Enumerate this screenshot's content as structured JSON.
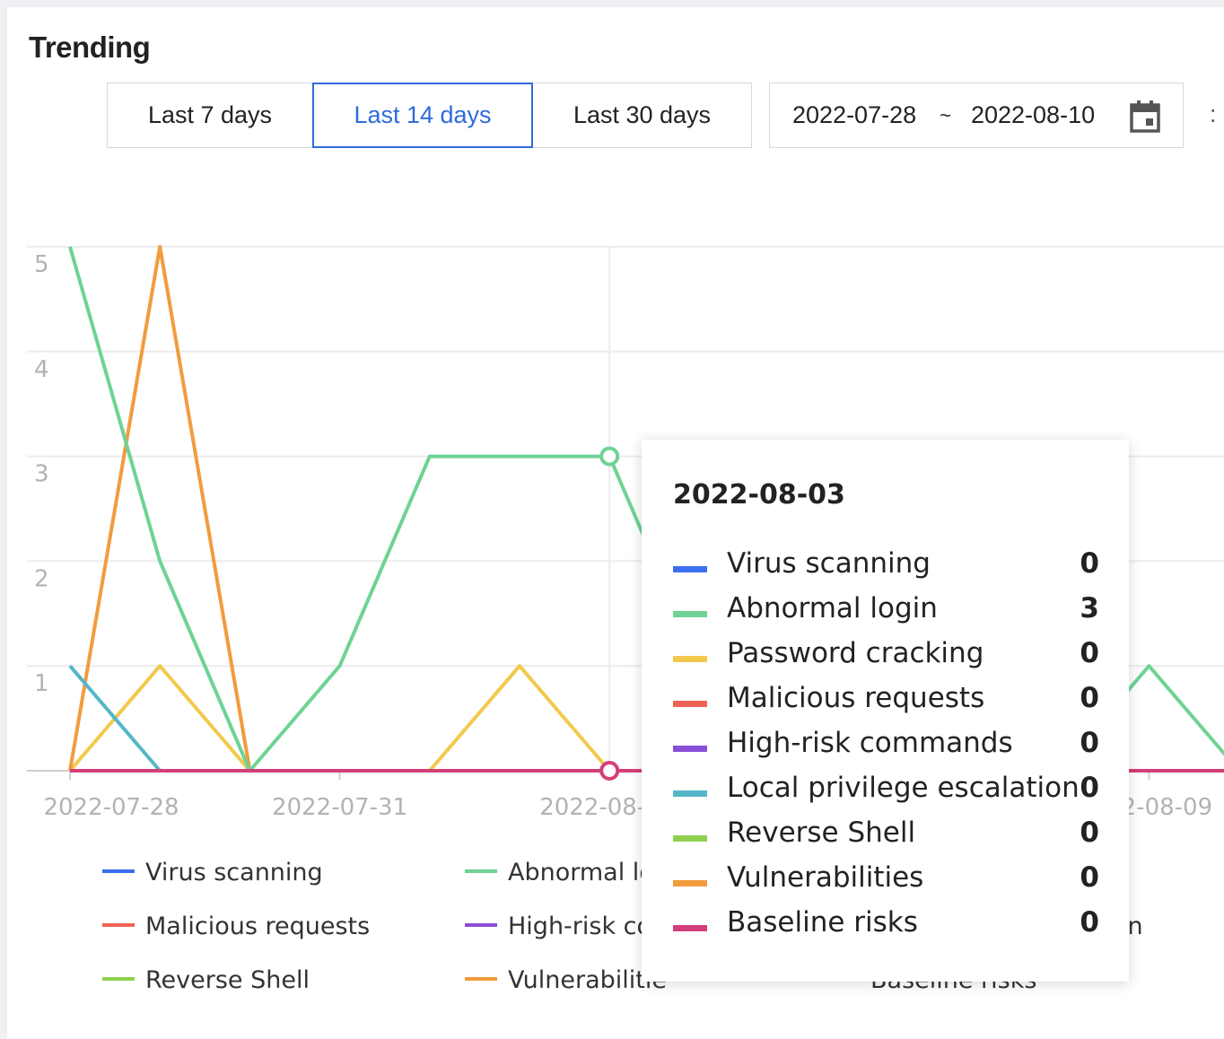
{
  "panel": {
    "title": "Trending",
    "range_buttons": [
      {
        "label": "Last 7 days",
        "active": false
      },
      {
        "label": "Last 14 days",
        "active": true
      },
      {
        "label": "Last 30 days",
        "active": false
      }
    ],
    "date_range": {
      "start": "2022-07-28",
      "separator": "~",
      "end": "2022-08-10"
    },
    "accent_color": "#2f6bdb",
    "calendar_icon": "calendar-icon"
  },
  "chart_data": {
    "type": "line",
    "x": [
      "2022-07-28",
      "2022-07-29",
      "2022-07-30",
      "2022-07-31",
      "2022-08-01",
      "2022-08-02",
      "2022-08-03",
      "2022-08-04",
      "2022-08-05",
      "2022-08-06",
      "2022-08-07",
      "2022-08-08",
      "2022-08-09",
      "2022-08-10"
    ],
    "x_tick_labels": [
      "2022-07-28",
      "2022-07-31",
      "2022-08-",
      "2-08-09"
    ],
    "ylim": [
      0,
      5
    ],
    "y_ticks": [
      1,
      2,
      3,
      4,
      5
    ],
    "grid": true,
    "legend_position": "bottom",
    "series": [
      {
        "name": "Virus scanning",
        "color": "#3b6ff0",
        "values": [
          0,
          0,
          0,
          0,
          0,
          0,
          0,
          0,
          0,
          0,
          0,
          0,
          0,
          0
        ]
      },
      {
        "name": "Abnormal login",
        "color": "#6ed394",
        "values": [
          5,
          2,
          0,
          1,
          3,
          3,
          3,
          1,
          1,
          1,
          1,
          0,
          1,
          0
        ]
      },
      {
        "name": "Password cracking",
        "color": "#f2c94c",
        "values": [
          0,
          1,
          0,
          0,
          0,
          1,
          0,
          0,
          0,
          0,
          0,
          0,
          0,
          0
        ]
      },
      {
        "name": "Malicious requests",
        "color": "#ee6454",
        "values": [
          0,
          0,
          0,
          0,
          0,
          0,
          0,
          0,
          0,
          0,
          0,
          0,
          0,
          0
        ]
      },
      {
        "name": "High-risk commands",
        "color": "#8a4fd8",
        "values": [
          0,
          0,
          0,
          0,
          0,
          0,
          0,
          0,
          0,
          0,
          0,
          0,
          0,
          0
        ]
      },
      {
        "name": "Local privilege escalation",
        "color": "#54b6c8",
        "values": [
          1,
          0,
          0,
          0,
          0,
          0,
          0,
          0,
          0,
          0,
          0,
          0,
          0,
          0
        ]
      },
      {
        "name": "Reverse Shell",
        "color": "#8fd14f",
        "values": [
          0,
          0,
          0,
          0,
          0,
          0,
          0,
          0,
          0,
          0,
          0,
          0,
          0,
          0
        ]
      },
      {
        "name": "Vulnerabilities",
        "color": "#f29c3c",
        "values": [
          0,
          5,
          0,
          0,
          0,
          0,
          0,
          0,
          0,
          0,
          0,
          0,
          0,
          0
        ]
      },
      {
        "name": "Baseline risks",
        "color": "#d43f7a",
        "values": [
          0,
          0,
          0,
          0,
          0,
          0,
          0,
          0,
          0,
          0,
          0,
          0,
          0,
          0
        ]
      }
    ],
    "legend_visible": [
      {
        "label": "Virus scanning",
        "color": "#3b6ff0"
      },
      {
        "label": "Abnormal lo",
        "color": "#6ed394"
      },
      {
        "label": "Malicious requests",
        "color": "#ee6454"
      },
      {
        "label": "High-risk co",
        "color": "#8a4fd8"
      },
      {
        "label": "Reverse Shell",
        "color": "#8fd14f"
      },
      {
        "label": "Vulnerabilitie",
        "color": "#f29c3c"
      },
      {
        "label": "on",
        "color": ""
      },
      {
        "label": "Baseline risks",
        "color": ""
      }
    ],
    "tooltip": {
      "date": "2022-08-03",
      "hover_index": 6,
      "rows": [
        {
          "label": "Virus scanning",
          "value": "0",
          "color": "#3b6ff0"
        },
        {
          "label": "Abnormal login",
          "value": "3",
          "color": "#6ed394"
        },
        {
          "label": "Password cracking",
          "value": "0",
          "color": "#f2c94c"
        },
        {
          "label": "Malicious requests",
          "value": "0",
          "color": "#ee6454"
        },
        {
          "label": "High-risk commands",
          "value": "0",
          "color": "#8a4fd8"
        },
        {
          "label": "Local privilege escalation",
          "value": "0",
          "color": "#54b6c8"
        },
        {
          "label": "Reverse Shell",
          "value": "0",
          "color": "#8fd14f"
        },
        {
          "label": "Vulnerabilities",
          "value": "0",
          "color": "#f29c3c"
        },
        {
          "label": "Baseline risks",
          "value": "0",
          "color": "#d43f7a"
        }
      ]
    }
  }
}
